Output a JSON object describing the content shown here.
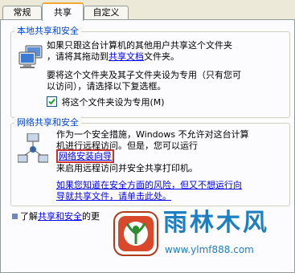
{
  "tabs": [
    "常规",
    "共享",
    "自定义"
  ],
  "local": {
    "title": "本地共享和安全",
    "p1_a": "如果只跟这台计算机的其他用户共享这个文件夹",
    "p1_b": "，请将其拖动到",
    "p1_link": "共享文档",
    "p1_c": "文件夹。",
    "p2_a": "要将这个文件夹及其子文件夹设为专用（只有您可",
    "p2_b": "以访问），请选择以下复选框。",
    "checkbox_label": "将这个文件夹设为专用(M)"
  },
  "network": {
    "title": "网络共享和安全",
    "p1_a": "作为一个安全措施，Windows 不允许对这台计算",
    "p1_b": "机进行远程访问。但是，您可以运行",
    "p1_link": "网络安装向导",
    "p1_c": "来启用远程访问并安全共享打印机。",
    "p2_a": "如果您知道在安全方面的风险，但又不想运行向",
    "p2_b": "导就共享文件，请单击此处。"
  },
  "bottom": {
    "prefix": "了解",
    "link": "共享和安全",
    "suffix": "的更"
  },
  "watermark": {
    "title": "雨林木风",
    "url": "www.ylmf888.com"
  },
  "colors": {
    "legend": "#0046d5",
    "link": "#0000ff",
    "highlight_box": "#c8312c",
    "watermark_text": "#1e7fc0",
    "tab_active_top": "#f5a830"
  },
  "icons": {
    "local_group": "shared-computers-icon",
    "network_group": "network-icon",
    "watermark_logo": "ylmf-logo"
  }
}
